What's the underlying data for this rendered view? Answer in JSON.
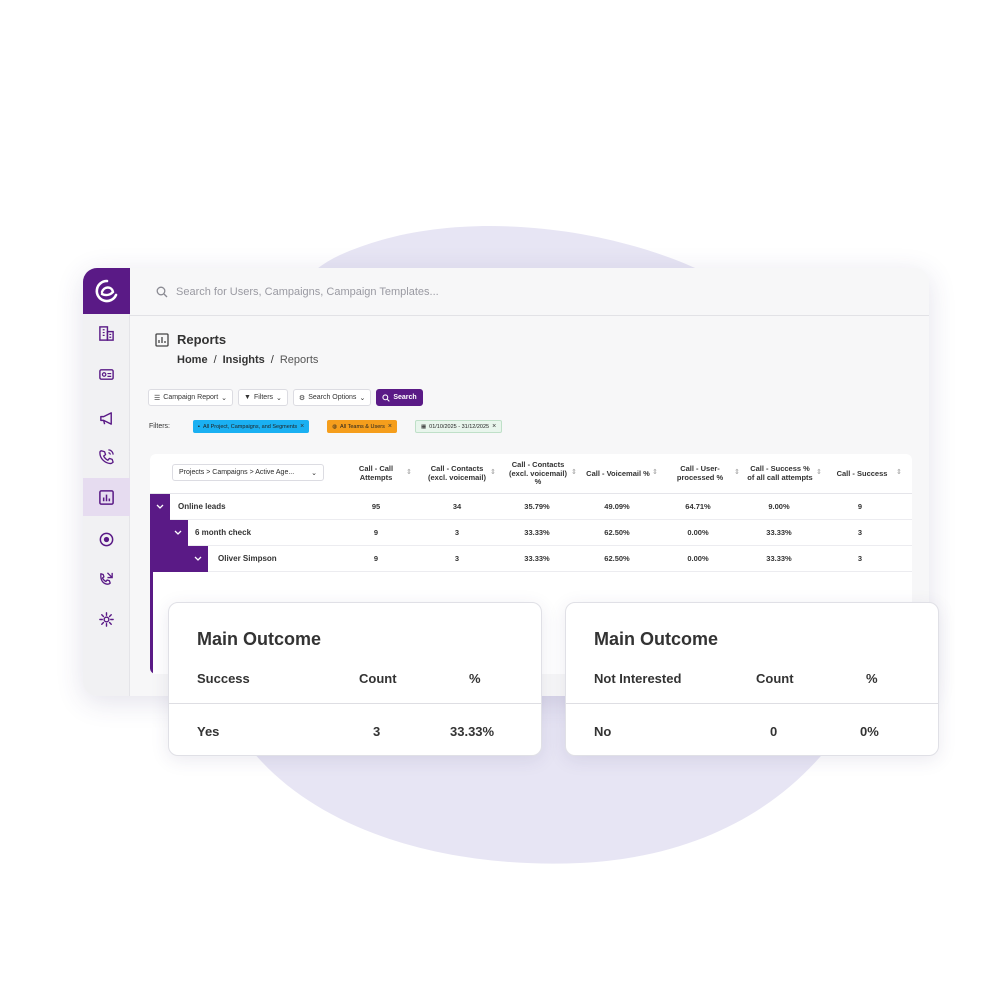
{
  "search": {
    "placeholder": "Search for Users, Campaigns, Campaign Templates..."
  },
  "page": {
    "title": "Reports",
    "breadcrumb": {
      "home": "Home",
      "sep": "/",
      "insights": "Insights",
      "current": "Reports"
    }
  },
  "toolbar": {
    "campaign_report": "Campaign Report",
    "filters": "Filters",
    "search_options": "Search Options",
    "search": "Search"
  },
  "filters": {
    "label": "Filters:",
    "chips": [
      "All Project, Campaigns, and Segments",
      "All Teams & Users",
      "01/10/2025 - 31/12/2025"
    ]
  },
  "table": {
    "dimension_select": "Projects > Campaigns > Active Age...",
    "columns": [
      "Call - Call Attempts",
      "Call - Contacts (excl. voicemail)",
      "Call - Contacts (excl. voicemail) %",
      "Call - Voicemail %",
      "Call - User-processed %",
      "Call - Success % of all call attempts",
      "Call - Success"
    ],
    "rows": [
      {
        "label": "Online leads",
        "values": [
          "95",
          "34",
          "35.79%",
          "49.09%",
          "64.71%",
          "9.00%",
          "9"
        ]
      },
      {
        "label": "6 month check",
        "values": [
          "9",
          "3",
          "33.33%",
          "62.50%",
          "0.00%",
          "33.33%",
          "3"
        ]
      },
      {
        "label": "Oliver Simpson",
        "values": [
          "9",
          "3",
          "33.33%",
          "62.50%",
          "0.00%",
          "33.33%",
          "3"
        ]
      }
    ]
  },
  "cards": [
    {
      "title": "Main Outcome",
      "col1": "Success",
      "col2": "Count",
      "col3": "%",
      "row": {
        "label": "Yes",
        "count": "3",
        "pct": "33.33%"
      }
    },
    {
      "title": "Main Outcome",
      "col1": "Not Interested",
      "col2": "Count",
      "col3": "%",
      "row": {
        "label": "No",
        "count": "0",
        "pct": "0%"
      }
    }
  ],
  "colors": {
    "brand": "#5a1a86",
    "blob": "#e7e5f4",
    "chip_blue": "#1ab0f2",
    "chip_orange": "#f59e1c"
  },
  "icons": {
    "logo": "brand-logo-icon",
    "nav": [
      "building-icon",
      "id-card-icon",
      "megaphone-icon",
      "phone-call-icon",
      "reports-icon",
      "target-icon",
      "missed-call-icon",
      "settings-icon"
    ]
  }
}
